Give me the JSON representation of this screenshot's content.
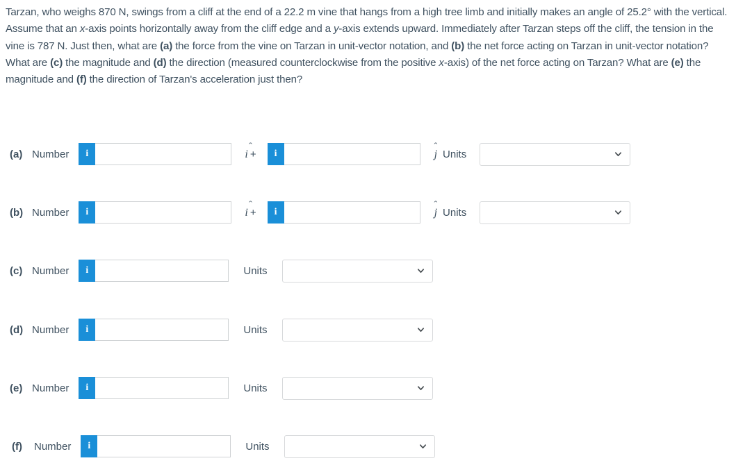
{
  "question": {
    "segments": [
      {
        "text": "Tarzan, who weighs ",
        "style": "normal"
      },
      {
        "text": "870 N",
        "style": "normal"
      },
      {
        "text": ", swings from a cliff at the end of a 22.2 m vine that hangs from a high tree limb and initially makes an angle of 25.2° with the vertical. Assume that an ",
        "style": "normal"
      },
      {
        "text": "x",
        "style": "italic"
      },
      {
        "text": "-axis points horizontally away from the cliff edge and a ",
        "style": "normal"
      },
      {
        "text": "y",
        "style": "italic"
      },
      {
        "text": "-axis extends upward. Immediately after Tarzan steps off the cliff, the tension in the vine is 787 N. Just then, what are ",
        "style": "normal"
      },
      {
        "text": "(a)",
        "style": "bold"
      },
      {
        "text": " the force from the vine on Tarzan in unit-vector notation, and ",
        "style": "normal"
      },
      {
        "text": "(b)",
        "style": "bold"
      },
      {
        "text": " the net force acting on Tarzan in unit-vector notation? What are ",
        "style": "normal"
      },
      {
        "text": "(c)",
        "style": "bold"
      },
      {
        "text": " the magnitude and ",
        "style": "normal"
      },
      {
        "text": "(d)",
        "style": "bold"
      },
      {
        "text": " the direction (measured counterclockwise from the positive ",
        "style": "normal"
      },
      {
        "text": "x",
        "style": "italic"
      },
      {
        "text": "-axis) of the net force acting on Tarzan? What are ",
        "style": "normal"
      },
      {
        "text": "(e)",
        "style": "bold"
      },
      {
        "text": " the magnitude and ",
        "style": "normal"
      },
      {
        "text": "(f)",
        "style": "bold"
      },
      {
        "text": " the direction of Tarzan's acceleration just then?",
        "style": "normal"
      }
    ],
    "plain_text": "Tarzan, who weighs 870 N, swings from a cliff at the end of a 22.2 m vine that hangs from a high tree limb and initially makes an angle of 25.2° with the vertical. Assume that an x-axis points horizontally away from the cliff edge and a y-axis extends upward. Immediately after Tarzan steps off the cliff, the tension in the vine is 787 N. Just then, what are (a) the force from the vine on Tarzan in unit-vector notation, and (b) the net force acting on Tarzan in unit-vector notation? What are (c) the magnitude and (d) the direction (measured counterclockwise from the positive x-axis) of the net force acting on Tarzan? What are (e) the magnitude and (f) the direction of Tarzan's acceleration just then?"
  },
  "labels": {
    "number": "Number",
    "units": "Units",
    "info_badge": "i",
    "info_badge_icon": "info-icon",
    "chevron_icon": "chevron-down-icon",
    "i_hat_letter": "i",
    "j_hat_letter": "j",
    "hat_mark": "ˆ",
    "plus": "+"
  },
  "colors": {
    "info_badge_blue": "#1a8fd8",
    "text": "#3f5160",
    "input_border": "#cfd2d4",
    "select_border": "#d7d9db",
    "page_background": "#ffffff"
  },
  "rows": [
    {
      "id": "a",
      "part": "(a)",
      "type": "vector",
      "number_label": "Number",
      "value_i": "",
      "value_j": "",
      "placeholder_i": "",
      "placeholder_j": "",
      "units_label": "Units",
      "unit_value": ""
    },
    {
      "id": "b",
      "part": "(b)",
      "type": "vector",
      "number_label": "Number",
      "value_i": "",
      "value_j": "",
      "placeholder_i": "",
      "placeholder_j": "",
      "units_label": "Units",
      "unit_value": ""
    },
    {
      "id": "c",
      "part": "(c)",
      "type": "scalar",
      "number_label": "Number",
      "value": "",
      "placeholder": "",
      "units_label": "Units",
      "unit_value": ""
    },
    {
      "id": "d",
      "part": "(d)",
      "type": "scalar",
      "number_label": "Number",
      "value": "",
      "placeholder": "",
      "units_label": "Units",
      "unit_value": ""
    },
    {
      "id": "e",
      "part": "(e)",
      "type": "scalar",
      "number_label": "Number",
      "value": "",
      "placeholder": "",
      "units_label": "Units",
      "unit_value": ""
    },
    {
      "id": "f",
      "part": "(f)",
      "type": "scalar",
      "number_label": "Number",
      "value": "",
      "placeholder": "",
      "units_label": "Units",
      "unit_value": ""
    }
  ]
}
